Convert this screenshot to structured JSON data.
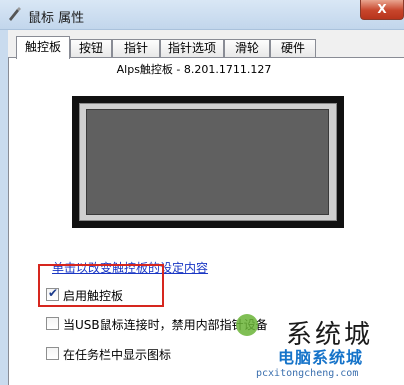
{
  "window": {
    "title": "鼠标 属性",
    "close_glyph": "X"
  },
  "tabs": [
    {
      "label": "触控板",
      "active": true
    },
    {
      "label": "按钮",
      "active": false
    },
    {
      "label": "指针",
      "active": false
    },
    {
      "label": "指针选项",
      "active": false
    },
    {
      "label": "滑轮",
      "active": false
    },
    {
      "label": "硬件",
      "active": false
    }
  ],
  "panel": {
    "device_label": "Alps触控板 - 8.201.1711.127",
    "settings_link": "单击以改变触控板的设定内容",
    "options": [
      {
        "label": "启用触控板",
        "checked": true
      },
      {
        "label": "当USB鼠标连接时，禁用内部指针设备",
        "checked": false
      },
      {
        "label": "在任务栏中显示图标",
        "checked": false
      }
    ]
  },
  "watermark": {
    "title": "系统城",
    "subtitle": "电脑系统城",
    "url": "pcxitongcheng.com"
  },
  "colors": {
    "highlight_box": "#d6261e",
    "link": "#1a37c4",
    "titlebar": "#c9dbee"
  }
}
